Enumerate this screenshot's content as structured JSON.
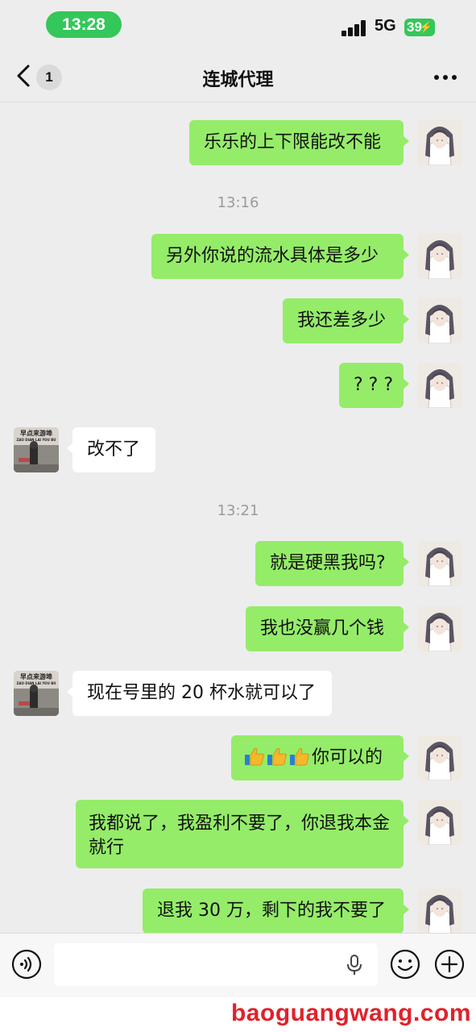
{
  "status_bar": {
    "time": "13:28",
    "network": "5G",
    "battery": "39"
  },
  "nav": {
    "unread_count": "1",
    "title": "连城代理"
  },
  "messages": [
    {
      "text": "乐乐的上下限能改不能"
    },
    {
      "timestamp": "13:16"
    },
    {
      "text": "另外你说的流水具体是多少"
    },
    {
      "text": "我还差多少"
    },
    {
      "text": "? ? ?"
    },
    {
      "text": "改不了"
    },
    {
      "timestamp": "13:21"
    },
    {
      "text": "就是硬黑我吗?"
    },
    {
      "text": "我也没赢几个钱"
    },
    {
      "text": "现在号里的 20 杯水就可以了"
    },
    {
      "text": "你可以的",
      "emoji": "thumbs-up",
      "emoji_count": 3
    },
    {
      "text": "我都说了，我盈利不要了，你退我本金就行"
    },
    {
      "text": "退我 30 万，剩下的我不要了"
    }
  ],
  "contact_avatar_sign": {
    "line1": "早点来游埠",
    "line2": "ZAO DIAN LAI YOU BU"
  },
  "input": {
    "placeholder": ""
  },
  "watermark": "baoguangwang.com",
  "colors": {
    "my_bubble": "#95ec69",
    "other_bubble": "#ffffff",
    "background": "#ededed",
    "status_pill": "#34c759",
    "watermark": "#e0222b"
  },
  "icons": [
    "back-icon",
    "more-icon",
    "voice-icon",
    "mic-icon",
    "emoji-icon",
    "plus-icon",
    "thumbs-up-icon"
  ]
}
